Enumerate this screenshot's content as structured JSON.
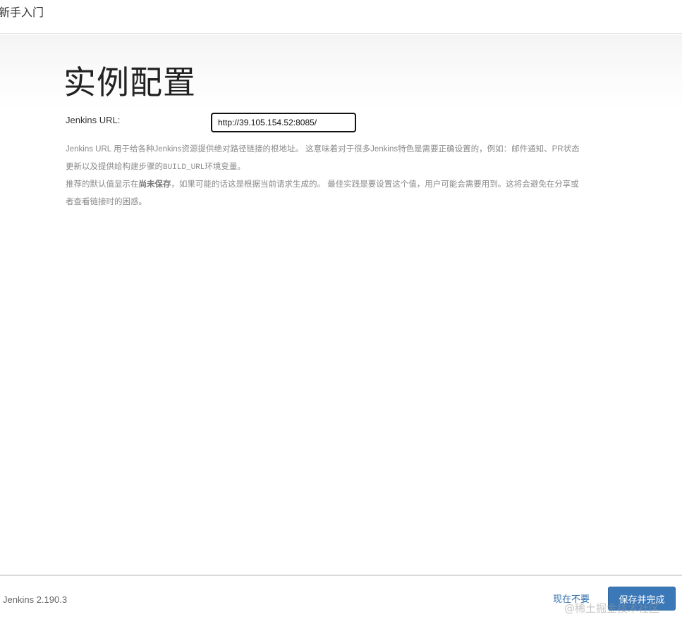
{
  "header": {
    "title": "新手入门"
  },
  "main": {
    "heading": "实例配置",
    "url_label": "Jenkins URL:",
    "url_value": "http://39.105.154.52:8085/",
    "help": {
      "p1_a": "Jenkins URL 用于给各种Jenkins资源提供绝对路径链接的根地址。 这意味着对于很多Jenkins特色是需要正确设置的，例如：邮件通知、PR状态",
      "p1_b": "更新以及提供给构建步骤的",
      "p1_code": "BUILD_URL",
      "p1_c": "环境变量。",
      "p2_a": "推荐的默认值显示在",
      "p2_bold": "尚未保存",
      "p2_b": "，如果可能的话这是根据当前请求生成的。 最佳实践是要设置这个值，用户可能会需要用到。这将会避免在分享或",
      "p2_c": "者查看链接时的困惑。"
    }
  },
  "footer": {
    "version": "Jenkins 2.190.3",
    "skip_label": "现在不要",
    "save_label": "保存并完成",
    "watermark": "@稀土掘金技术社区"
  }
}
